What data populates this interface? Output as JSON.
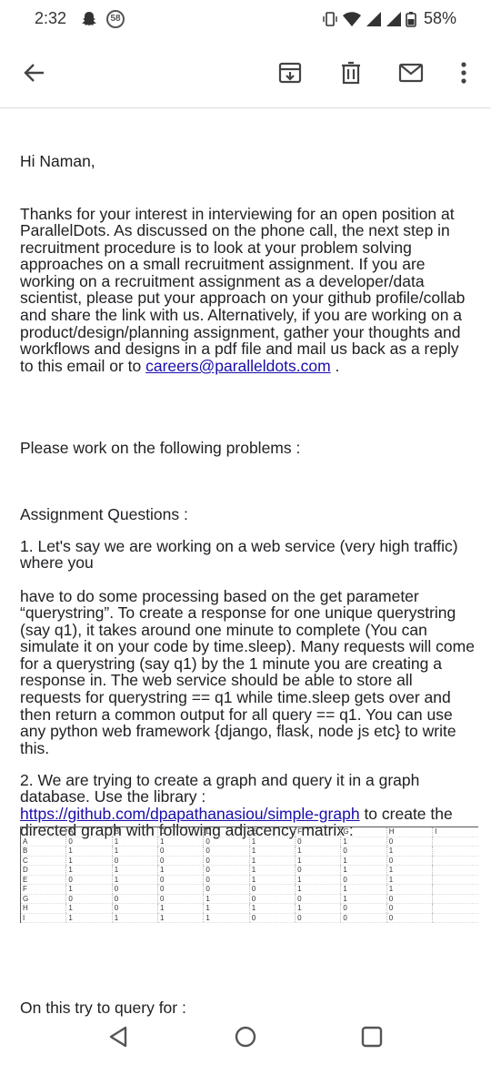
{
  "status": {
    "time": "2:32",
    "badge": "58",
    "battery": "58%"
  },
  "email": {
    "greeting": "Hi Naman,",
    "intro_text": "Thanks for your interest in interviewing for an open position at ParallelDots. As discussed on the phone call, the next step in recruitment procedure is to look at your problem solving approaches on a small recruitment assignment. If you are working on a recruitment assignment as a developer/data scientist, please put your approach on your github profile/collab and share the link with us. Alternatively, if you are working on a product/design/planning assignment, gather your thoughts and workflows and designs in a pdf file and mail us back as a reply to this email or to ",
    "intro_link": "careers@paralleldots.com",
    "intro_end": " .",
    "please": "Please work on the following problems :",
    "assignment_title": "Assignment Questions :",
    "q1_part1": "1. Let's say we are working on a web service (very high traffic) where you",
    "q1_part2": "have to do some processing based on the get parameter “querystring”. To create a response for one unique querystring (say q1), it takes around one minute to complete (You can simulate it on your code by time.sleep). Many requests will come for a querystring (say q1) by the 1 minute you are creating a response in. The web service should be able to store all requests for querystring == q1 while time.sleep gets over and then return a common output for all query == q1. You can use any python web framework {django, flask, node js etc} to write this.",
    "q2_part1": "2. We are trying to create a graph and query it in a graph database. Use the library : ",
    "q2_link": "https://github.com/dpapathanasiou/simple-graph",
    "q2_part2": " to create the directed graph with following adjacency matrix :",
    "tail": "On this try to query for :"
  },
  "matrix": {
    "header": [
      "",
      "A",
      "B",
      "C",
      "D",
      "E",
      "F",
      "G",
      "H",
      "I"
    ],
    "rows": [
      [
        "A",
        "0",
        "1",
        "1",
        "0",
        "1",
        "0",
        "1",
        "0"
      ],
      [
        "B",
        "1",
        "1",
        "0",
        "0",
        "1",
        "1",
        "0",
        "1"
      ],
      [
        "C",
        "1",
        "0",
        "0",
        "0",
        "1",
        "1",
        "1",
        "0"
      ],
      [
        "D",
        "1",
        "1",
        "1",
        "0",
        "1",
        "0",
        "1",
        "1"
      ],
      [
        "E",
        "0",
        "1",
        "0",
        "0",
        "1",
        "1",
        "0",
        "1"
      ],
      [
        "F",
        "1",
        "0",
        "0",
        "0",
        "0",
        "1",
        "1",
        "1"
      ],
      [
        "G",
        "0",
        "0",
        "0",
        "1",
        "0",
        "0",
        "1",
        "0"
      ],
      [
        "H",
        "1",
        "0",
        "1",
        "1",
        "1",
        "1",
        "0",
        "0"
      ],
      [
        "I",
        "1",
        "1",
        "1",
        "1",
        "0",
        "0",
        "0",
        "0"
      ]
    ]
  },
  "icons": {
    "back": "arrow-back-icon",
    "archive": "archive-icon",
    "delete": "trash-icon",
    "mail": "mail-icon",
    "more": "more-vert-icon"
  }
}
